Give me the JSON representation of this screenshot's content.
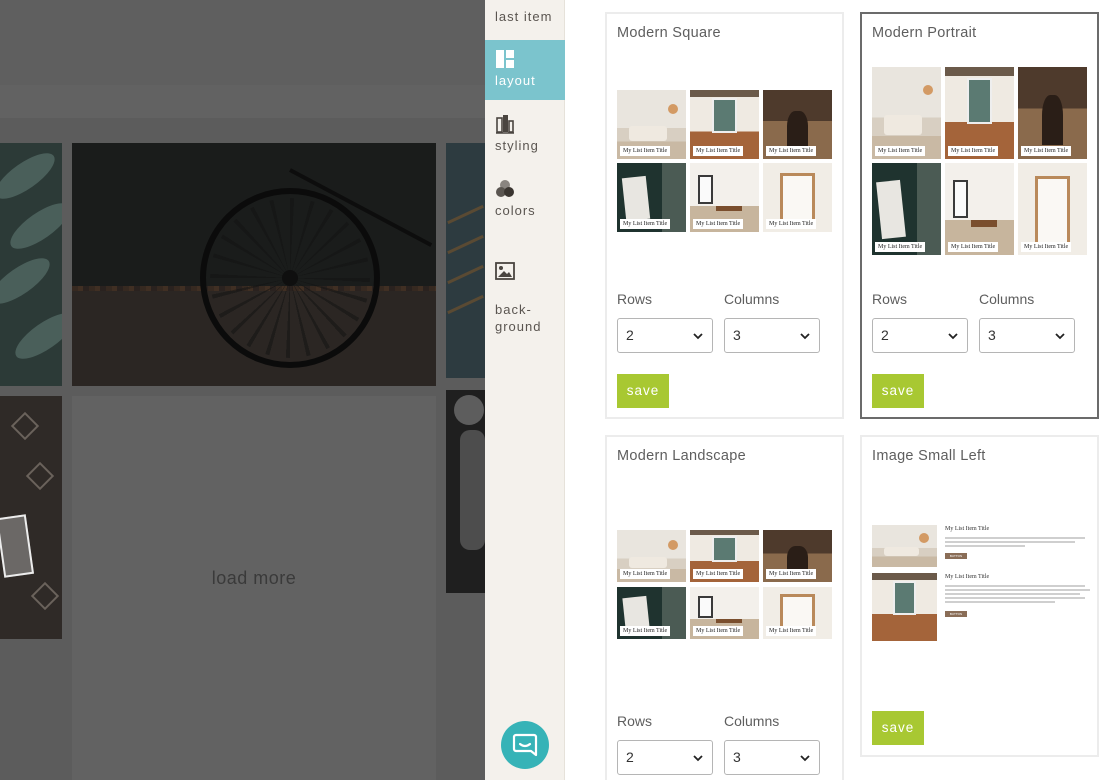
{
  "preview": {
    "load_more_label": "load more"
  },
  "sidenav": {
    "items": [
      {
        "label": "last item",
        "icon": "last-item-icon"
      },
      {
        "label": "layout",
        "icon": "layout-icon",
        "active": true
      },
      {
        "label": "styling",
        "icon": "styling-icon"
      },
      {
        "label": "colors",
        "icon": "colors-icon"
      },
      {
        "label": "back-\nground",
        "icon": "background-image-icon"
      }
    ]
  },
  "layouts": [
    {
      "name": "Modern Square",
      "item_caption": "My List Item Title",
      "rows_label": "Rows",
      "columns_label": "Columns",
      "rows_value": "2",
      "columns_value": "3",
      "save_label": "save",
      "selected": false
    },
    {
      "name": "Modern Portrait",
      "item_caption": "My List Item Title",
      "rows_label": "Rows",
      "columns_label": "Columns",
      "rows_value": "2",
      "columns_value": "3",
      "save_label": "save",
      "selected": true
    },
    {
      "name": "Modern Landscape",
      "item_caption": "My List Item Title",
      "rows_label": "Rows",
      "columns_label": "Columns",
      "rows_value": "2",
      "columns_value": "3",
      "save_label": "save",
      "selected": false
    },
    {
      "name": "Image Small Left",
      "item_caption": "My List Item Title",
      "item_button": "BUTTON",
      "save_label": "save",
      "selected": false
    }
  ],
  "colors": {
    "accent_nav": "#7bc4cd",
    "save_green": "#a8c832",
    "chat_teal": "#36b3b7"
  },
  "chat": {
    "icon": "chat-bubble-icon"
  }
}
